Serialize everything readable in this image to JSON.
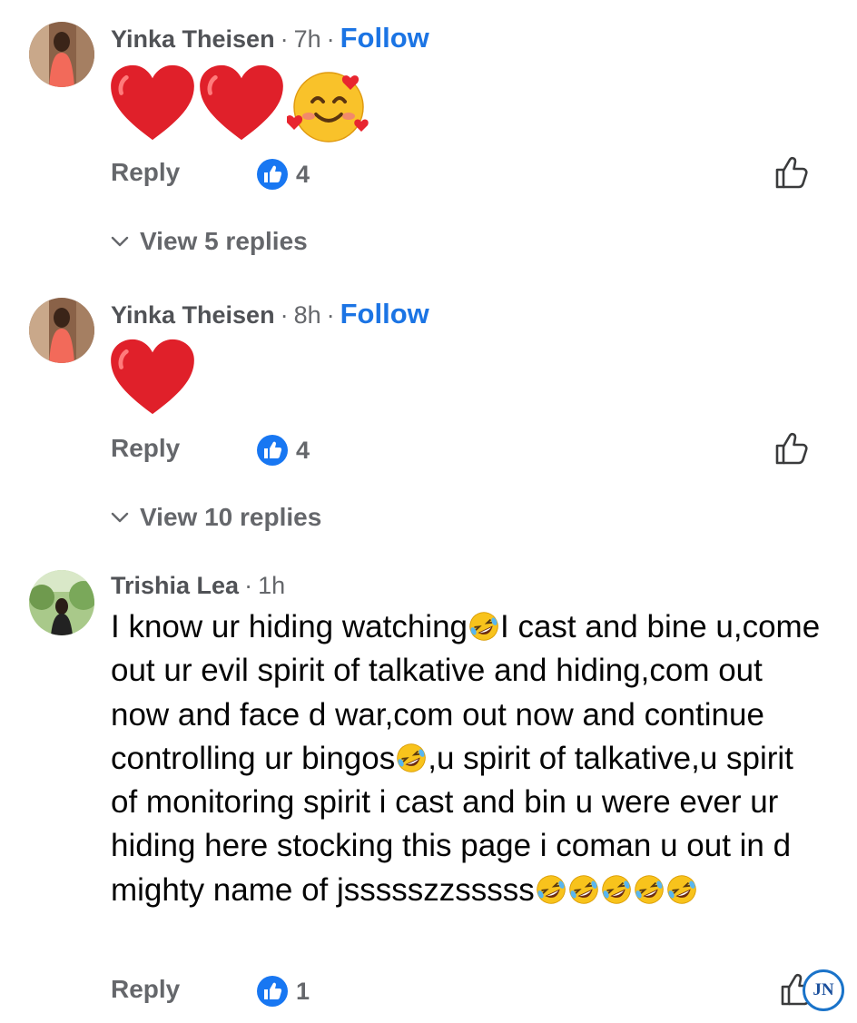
{
  "comments": [
    {
      "name": "Yinka Theisen",
      "time": "7h",
      "follow": "Follow",
      "emojis": [
        "red-heart",
        "red-heart",
        "smiling-face-with-hearts"
      ],
      "reply": "Reply",
      "reactions": "4",
      "view_replies": "View 5 replies"
    },
    {
      "name": "Yinka Theisen",
      "time": "8h",
      "follow": "Follow",
      "emojis": [
        "red-heart"
      ],
      "reply": "Reply",
      "reactions": "4",
      "view_replies": "View 10 replies"
    },
    {
      "name": "Trishia Lea",
      "time": "1h",
      "text_parts": [
        "I know ur hiding watching",
        "I cast and bine u,come out ur evil spirit of talkative and hiding,com out now and face d war,com out now and continue controlling ur bingos",
        ",u spirit of talkative,u spirit of monitoring spirit i cast and bin u were ever ur hiding here stocking this page i coman u out in d mighty name of jssssszzsssss"
      ],
      "reply": "Reply",
      "reactions": "1"
    }
  ],
  "watermark": "JN",
  "colors": {
    "follow": "#1b74e4",
    "like_badge": "#1877f2",
    "secondary_text": "#65676b"
  },
  "icons": [
    "red-heart-icon",
    "smiling-face-with-hearts-icon",
    "rolling-laughing-icon",
    "thumbs-up-icon",
    "chevron-down-icon"
  ]
}
